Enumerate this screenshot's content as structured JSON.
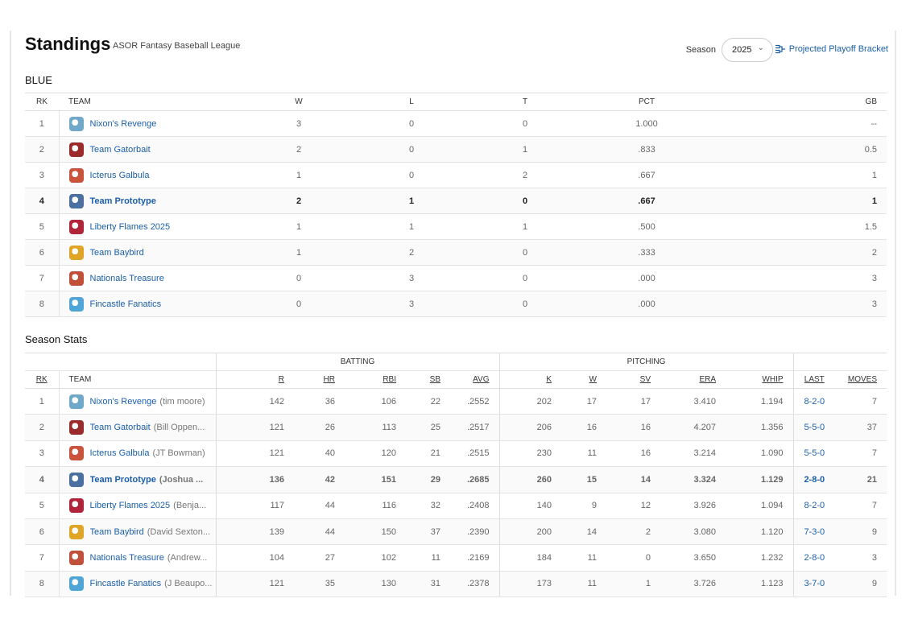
{
  "header": {
    "title": "Standings",
    "subtitle": "ASOR Fantasy Baseball League",
    "season_label": "Season",
    "season_value": "2025",
    "bracket_link": "Projected Playoff Bracket"
  },
  "division": {
    "name": "BLUE",
    "columns": [
      "RK",
      "TEAM",
      "W",
      "L",
      "T",
      "PCT",
      "GB"
    ],
    "rows": [
      {
        "rk": "1",
        "team": "Nixon's Revenge",
        "w": "3",
        "l": "0",
        "t": "0",
        "pct": "1.000",
        "gb": "--",
        "logo_color": "#6fa8c9"
      },
      {
        "rk": "2",
        "team": "Team Gatorbait",
        "w": "2",
        "l": "0",
        "t": "1",
        "pct": ".833",
        "gb": "0.5",
        "logo_color": "#9b2a2a"
      },
      {
        "rk": "3",
        "team": "Icterus Galbula",
        "w": "1",
        "l": "0",
        "t": "2",
        "pct": ".667",
        "gb": "1",
        "logo_color": "#c9533b"
      },
      {
        "rk": "4",
        "team": "Team Prototype",
        "w": "2",
        "l": "1",
        "t": "0",
        "pct": ".667",
        "gb": "1",
        "logo_color": "#4a6fa0"
      },
      {
        "rk": "5",
        "team": "Liberty Flames 2025",
        "w": "1",
        "l": "1",
        "t": "1",
        "pct": ".500",
        "gb": "1.5",
        "logo_color": "#b0253a"
      },
      {
        "rk": "6",
        "team": "Team Baybird",
        "w": "1",
        "l": "2",
        "t": "0",
        "pct": ".333",
        "gb": "2",
        "logo_color": "#e0a526"
      },
      {
        "rk": "7",
        "team": "Nationals Treasure",
        "w": "0",
        "l": "3",
        "t": "0",
        "pct": ".000",
        "gb": "3",
        "logo_color": "#c0503a"
      },
      {
        "rk": "8",
        "team": "Fincastle Fanatics",
        "w": "0",
        "l": "3",
        "t": "0",
        "pct": ".000",
        "gb": "3",
        "logo_color": "#4fa6d6"
      }
    ]
  },
  "season_stats": {
    "title": "Season Stats",
    "group_batting": "BATTING",
    "group_pitching": "PITCHING",
    "columns": [
      "RK",
      "TEAM",
      "R",
      "HR",
      "RBI",
      "SB",
      "AVG",
      "K",
      "W",
      "SV",
      "ERA",
      "WHIP",
      "LAST",
      "MOVES"
    ],
    "rows": [
      {
        "rk": "1",
        "team": "Nixon's Revenge",
        "owner": "(tim moore)",
        "r": "142",
        "hr": "36",
        "rbi": "106",
        "sb": "22",
        "avg": ".2552",
        "k": "202",
        "w": "17",
        "sv": "17",
        "era": "3.410",
        "whip": "1.194",
        "last": "8-2-0",
        "moves": "7"
      },
      {
        "rk": "2",
        "team": "Team Gatorbait",
        "owner": "(Bill Oppen...",
        "r": "121",
        "hr": "26",
        "rbi": "113",
        "sb": "25",
        "avg": ".2517",
        "k": "206",
        "w": "16",
        "sv": "16",
        "era": "4.207",
        "whip": "1.356",
        "last": "5-5-0",
        "moves": "37"
      },
      {
        "rk": "3",
        "team": "Icterus Galbula",
        "owner": "(JT Bowman)",
        "r": "121",
        "hr": "40",
        "rbi": "120",
        "sb": "21",
        "avg": ".2515",
        "k": "230",
        "w": "11",
        "sv": "16",
        "era": "3.214",
        "whip": "1.090",
        "last": "5-5-0",
        "moves": "7"
      },
      {
        "rk": "4",
        "team": "Team Prototype",
        "owner": "(Joshua ...",
        "r": "136",
        "hr": "42",
        "rbi": "151",
        "sb": "29",
        "avg": ".2685",
        "k": "260",
        "w": "15",
        "sv": "14",
        "era": "3.324",
        "whip": "1.129",
        "last": "2-8-0",
        "moves": "21"
      },
      {
        "rk": "5",
        "team": "Liberty Flames 2025",
        "owner": "(Benja...",
        "r": "117",
        "hr": "44",
        "rbi": "116",
        "sb": "32",
        "avg": ".2408",
        "k": "140",
        "w": "9",
        "sv": "12",
        "era": "3.926",
        "whip": "1.094",
        "last": "8-2-0",
        "moves": "7"
      },
      {
        "rk": "6",
        "team": "Team Baybird",
        "owner": "(David Sexton...",
        "r": "139",
        "hr": "44",
        "rbi": "150",
        "sb": "37",
        "avg": ".2390",
        "k": "200",
        "w": "14",
        "sv": "2",
        "era": "3.080",
        "whip": "1.120",
        "last": "7-3-0",
        "moves": "9"
      },
      {
        "rk": "7",
        "team": "Nationals Treasure",
        "owner": "(Andrew...",
        "r": "104",
        "hr": "27",
        "rbi": "102",
        "sb": "11",
        "avg": ".2169",
        "k": "184",
        "w": "11",
        "sv": "0",
        "era": "3.650",
        "whip": "1.232",
        "last": "2-8-0",
        "moves": "3"
      },
      {
        "rk": "8",
        "team": "Fincastle Fanatics",
        "owner": "(J Beaupo...",
        "r": "121",
        "hr": "35",
        "rbi": "130",
        "sb": "31",
        "avg": ".2378",
        "k": "173",
        "w": "11",
        "sv": "1",
        "era": "3.726",
        "whip": "1.123",
        "last": "3-7-0",
        "moves": "9"
      }
    ]
  },
  "highlight_row": 3,
  "accent": "#1a5fa8"
}
